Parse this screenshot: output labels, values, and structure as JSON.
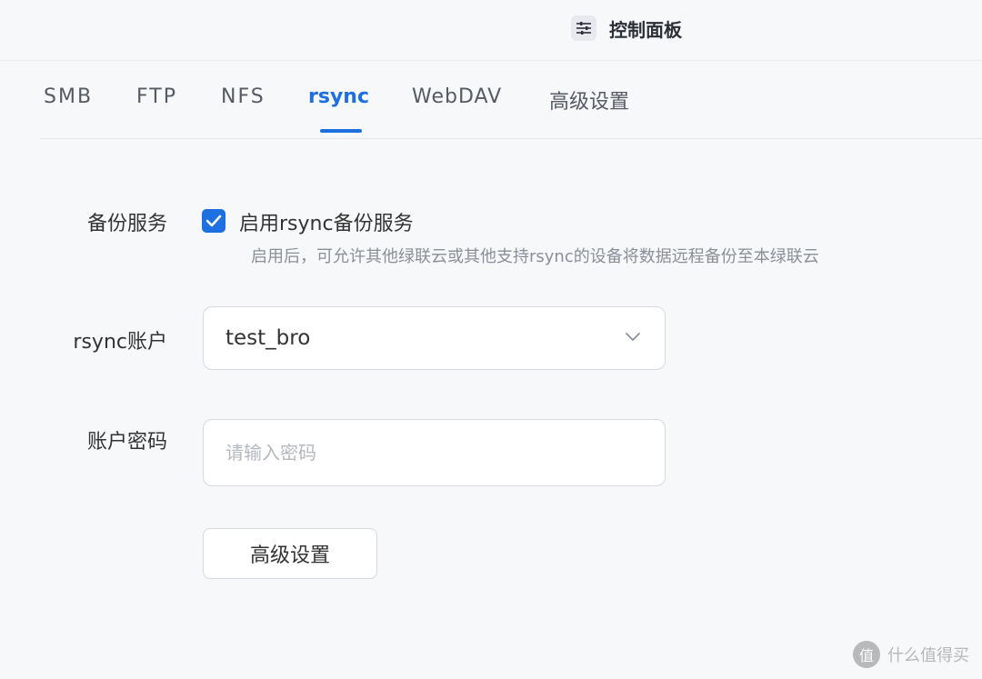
{
  "header": {
    "title": "控制面板",
    "icon": "sliders-icon"
  },
  "tabs": [
    {
      "label": "SMB",
      "active": false
    },
    {
      "label": "FTP",
      "active": false
    },
    {
      "label": "NFS",
      "active": false
    },
    {
      "label": "rsync",
      "active": true
    },
    {
      "label": "WebDAV",
      "active": false
    },
    {
      "label": "高级设置",
      "active": false
    }
  ],
  "form": {
    "backup_label": "备份服务",
    "enable_checked": true,
    "enable_label": "启用rsync备份服务",
    "enable_hint": "启用后，可允许其他绿联云或其他支持rsync的设备将数据远程备份至本绿联云",
    "account_label": "rsync账户",
    "account_value": "test_bro",
    "password_label": "账户密码",
    "password_value": "",
    "password_placeholder": "请输入密码",
    "advanced_button": "高级设置"
  },
  "watermark": {
    "symbol": "值",
    "text": "什么值得买"
  },
  "colors": {
    "accent": "#1e6fe0",
    "background": "#f7f8fa",
    "border": "#d5d8de"
  }
}
